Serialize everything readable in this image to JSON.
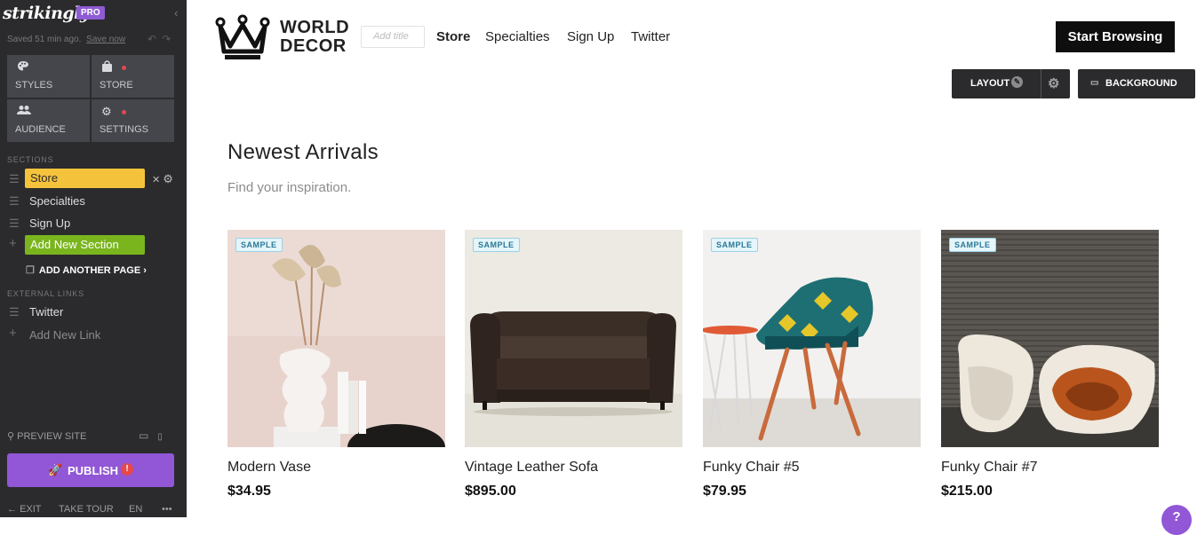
{
  "sidebar": {
    "brand": "strikingly",
    "pro_badge": "PRO",
    "saved_text": "Saved 51 min ago.",
    "save_now": "Save now",
    "tiles": [
      {
        "label": "STYLES",
        "icon": "palette-icon"
      },
      {
        "label": "STORE",
        "icon": "bag-icon",
        "alert": true
      },
      {
        "label": "AUDIENCE",
        "icon": "people-icon"
      },
      {
        "label": "SETTINGS",
        "icon": "gear-icon",
        "alert": true
      }
    ],
    "sections_heading": "SECTIONS",
    "sections": [
      {
        "label": "Store",
        "active": true
      },
      {
        "label": "Specialties"
      },
      {
        "label": "Sign Up"
      }
    ],
    "add_section": "Add New Section",
    "add_page": "ADD ANOTHER PAGE",
    "add_page_arrow": "›",
    "external_heading": "EXTERNAL LINKS",
    "external_links": [
      {
        "label": "Twitter"
      }
    ],
    "add_link": "Add New Link",
    "preview": "PREVIEW SITE",
    "publish": "PUBLISH",
    "publish_alert": "!",
    "footer": {
      "exit": "EXIT",
      "tour": "TAKE TOUR",
      "lang": "EN",
      "more": "•••"
    },
    "colors": {
      "accent_purple": "#9157d6",
      "active_section": "#f5c33b",
      "add_section": "#7ab51d",
      "alert": "#e5484d"
    }
  },
  "site": {
    "logo_line1": "WORLD",
    "logo_line2": "DECOR",
    "add_title_placeholder": "Add title",
    "nav": [
      {
        "label": "Store",
        "active": true
      },
      {
        "label": "Specialties"
      },
      {
        "label": "Sign Up"
      },
      {
        "label": "Twitter"
      }
    ],
    "cta": "Start Browsing",
    "layout_button": "LAYOUT",
    "background_button": "BACKGROUND",
    "section_title": "Newest Arrivals",
    "section_subtitle": "Find your inspiration.",
    "products": [
      {
        "name": "Modern Vase",
        "price": "$34.95",
        "badge": "SAMPLE"
      },
      {
        "name": "Vintage Leather Sofa",
        "price": "$895.00",
        "badge": "SAMPLE"
      },
      {
        "name": "Funky Chair #5",
        "price": "$79.95",
        "badge": "SAMPLE"
      },
      {
        "name": "Funky Chair #7",
        "price": "$215.00",
        "badge": "SAMPLE"
      }
    ],
    "help": "?"
  }
}
